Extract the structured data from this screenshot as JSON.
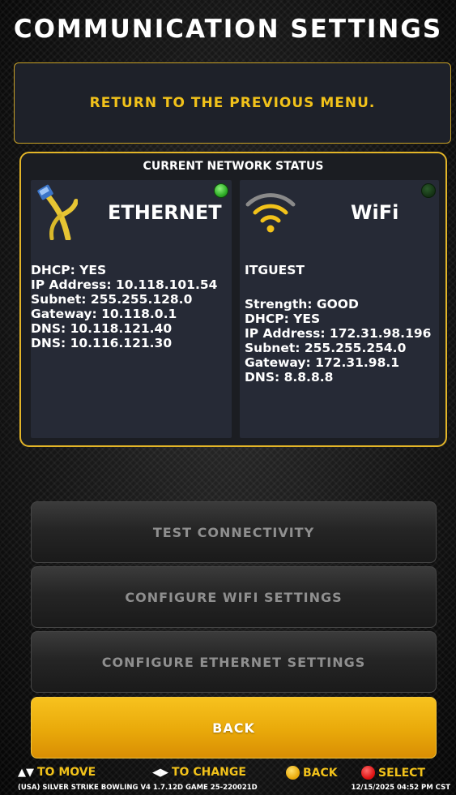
{
  "header": {
    "title": "COMMUNICATION SETTINGS"
  },
  "return_option": {
    "label": "RETURN TO THE PREVIOUS MENU."
  },
  "network_status": {
    "title": "CURRENT NETWORK STATUS",
    "ethernet": {
      "name": "ETHERNET",
      "icon": "ethernet-cable-icon",
      "status_color": "#2fae28",
      "lines": [
        "DHCP: YES",
        "IP Address: 10.118.101.54",
        "Subnet: 255.255.128.0",
        "Gateway: 10.118.0.1",
        "DNS: 10.118.121.40",
        "DNS: 10.116.121.30"
      ]
    },
    "wifi": {
      "name": "WiFi",
      "icon": "wifi-signal-icon",
      "status_color": "#143014",
      "ssid": "ITGUEST",
      "lines": [
        "Strength: GOOD",
        "DHCP: YES",
        "IP Address: 172.31.98.196",
        "Subnet: 255.255.254.0",
        "Gateway: 172.31.98.1",
        "DNS: 8.8.8.8"
      ]
    }
  },
  "buttons": {
    "test_connectivity": "TEST CONNECTIVITY",
    "configure_wifi": "CONFIGURE WIFI SETTINGS",
    "configure_ethernet": "CONFIGURE ETHERNET SETTINGS",
    "back": "BACK"
  },
  "hints": {
    "move": "TO MOVE",
    "change": "TO CHANGE",
    "back": "BACK",
    "select": "SELECT"
  },
  "footer": {
    "version": "(USA) SILVER STRIKE BOWLING V4  1.7.12D GAME 25-220021D",
    "datetime": "12/15/2025 04:52 PM CST"
  },
  "colors": {
    "accent": "#f2c21a",
    "panel_border": "#e3b528"
  }
}
